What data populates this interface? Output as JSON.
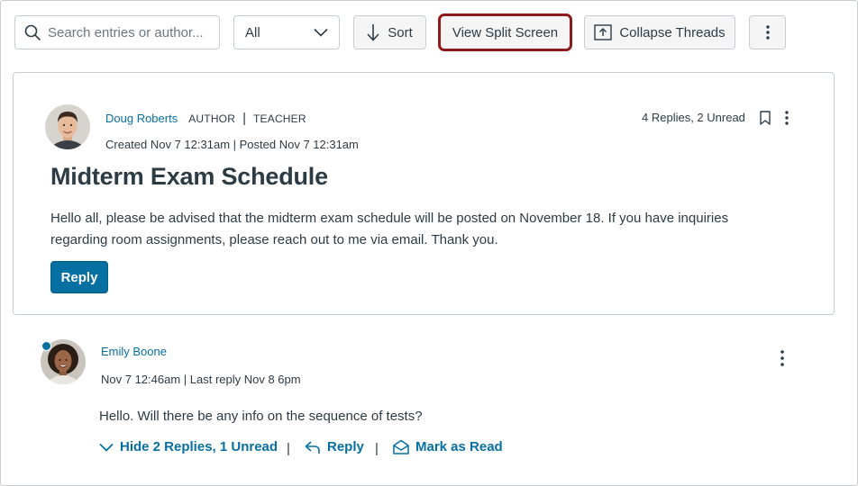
{
  "toolbar": {
    "search_placeholder": "Search entries or author...",
    "filter_value": "All",
    "sort_label": "Sort",
    "split_label": "View Split Screen",
    "collapse_label": "Collapse Threads"
  },
  "post": {
    "author": "Doug Roberts",
    "role_author": "AUTHOR",
    "role_separator": "|",
    "role_teacher": "TEACHER",
    "dates": "Created Nov 7 12:31am | Posted Nov 7 12:31am",
    "reply_summary": "4 Replies, 2 Unread",
    "title": "Midterm Exam Schedule",
    "body": "Hello all, please be advised that the midterm exam schedule will be posted on November 18. If you have inquiries regarding room assignments, please reach out to me via email. Thank you.",
    "reply_label": "Reply"
  },
  "entry": {
    "author": "Emily Boone",
    "dates": "Nov 7 12:46am | Last reply Nov 8 6pm",
    "body": "Hello. Will there be any info on the sequence of tests?",
    "hide_label": "Hide 2 Replies, 1 Unread",
    "reply_label": "Reply",
    "mark_label": "Mark as Read",
    "separator": "|"
  },
  "colors": {
    "link": "#0770a3",
    "text": "#2d3b45",
    "highlight_ring": "#8b1a1a",
    "border": "#c7cdd1"
  },
  "icons": [
    "search-icon",
    "chevron-down-icon",
    "arrow-down-icon",
    "collapse-icon",
    "more-vertical-icon",
    "bookmark-icon",
    "reply-arrow-icon",
    "envelope-open-icon"
  ]
}
